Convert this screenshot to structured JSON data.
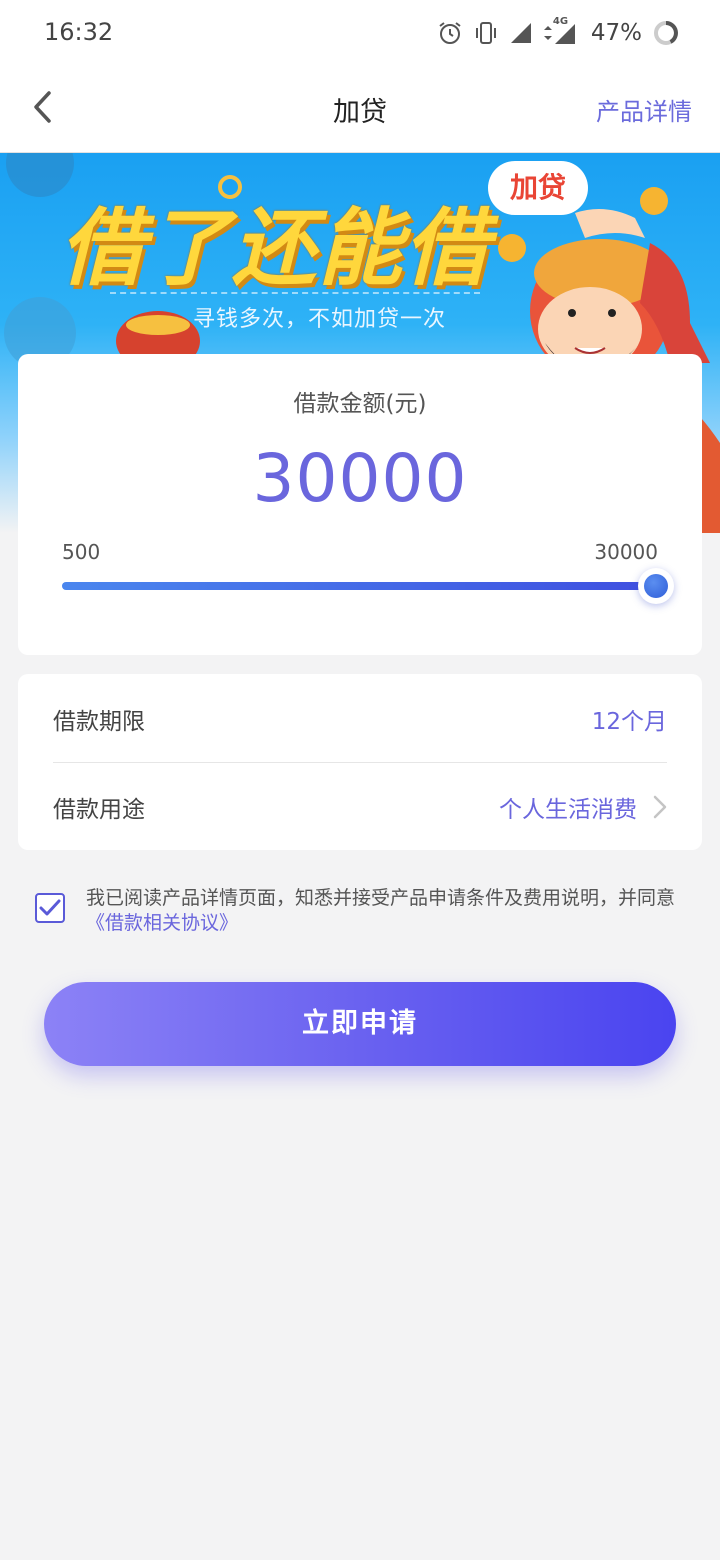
{
  "status_bar": {
    "time": "16:32",
    "battery": "47%",
    "network_label": "4G",
    "icons": [
      "alarm-icon",
      "vibrate-icon",
      "signal-icon",
      "data-arrows-icon",
      "battery-icon"
    ]
  },
  "nav": {
    "back_icon": "chevron-left-icon",
    "title": "加贷",
    "detail_link": "产品详情"
  },
  "banner": {
    "title": "借了还能借",
    "subtitle": "寻钱多次，不如加贷一次",
    "bubble": "加贷"
  },
  "loan_amount": {
    "label": "借款金额(元)",
    "value": "30000",
    "min": "500",
    "max": "30000",
    "slider_fraction": 1.0
  },
  "options": {
    "term_label": "借款期限",
    "term_value": "12个月",
    "purpose_label": "借款用途",
    "purpose_value": "个人生活消费"
  },
  "agreement": {
    "checked": true,
    "text": "我已阅读产品详情页面，知悉并接受产品申请条件及费用说明，并同意",
    "link": "《借款相关协议》"
  },
  "submit": {
    "label": "立即申请"
  },
  "colors": {
    "accent": "#6a66dd",
    "button_start": "#8c82f6",
    "button_end": "#4a44f0",
    "banner_blue": "#1aa0f2"
  }
}
